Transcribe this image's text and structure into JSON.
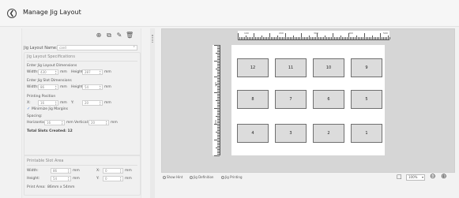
{
  "header": {
    "back_icon": "back-arrow-icon",
    "back_glyph": "❮",
    "title": "Manage Jig Layout"
  },
  "toolbar": {
    "add_glyph": "⊕",
    "copy_glyph": "⧉",
    "edit_glyph": "✎",
    "delete_glyph": "Ὕ1"
  },
  "jig": {
    "name_label": "Jig Layout Name:",
    "name_value": "card"
  },
  "specs": {
    "section_title": "Jig Layout Specifications",
    "layout_dims_label": "Enter Jig Layout Dimensions",
    "width_label": "Width:",
    "width_value": "430",
    "height_label": "Height:",
    "height_value": "287",
    "mm": "mm",
    "slot_dims_label": "Enter Jig Slot Dimensions",
    "slot_width_value": "86",
    "slot_height_value": "54",
    "printing_pos_label": "Printing Position",
    "x_label": "X:",
    "x_value": "16",
    "y_label": "Y:",
    "y_value": "20",
    "minimize_label": "Minimize Jig Margins",
    "spacing_label": "Spacing:",
    "horizontal_label": "Horizontal:",
    "horizontal_value": "16",
    "vertical_label": "Vertical:",
    "vertical_value": "20",
    "total_slots_label": "Total Slots Created: 12"
  },
  "printable": {
    "section_title": "Printable Slot Area",
    "width_label": "Width:",
    "width_value": "86",
    "height_label": "Height:",
    "height_value": "54",
    "x_label": "X:",
    "x_value": "0",
    "y_label": "Y:",
    "y_value": "0",
    "mm": "mm",
    "print_area_label": "Print Area:",
    "print_area_value": "86mm x 54mm"
  },
  "canvas": {
    "ruler_top_labels": [
      "100",
      "200",
      "300",
      "400",
      "500"
    ],
    "ruler_left_labels": [
      "100",
      "200"
    ],
    "slots_row1": [
      "12",
      "11",
      "10",
      "9"
    ],
    "slots_row2": [
      "8",
      "7",
      "6",
      "5"
    ],
    "slots_row3": [
      "4",
      "3",
      "2",
      "1"
    ]
  },
  "bottom": {
    "show_hint": "Show Hint",
    "jig_definition": "Jig Definition",
    "jig_printing": "Jig Printing",
    "zoom_value": "100%",
    "fit_icon": "fit-page-icon",
    "zoom_out_icon": "zoom-out-icon",
    "zoom_in_icon": "zoom-in-icon"
  }
}
